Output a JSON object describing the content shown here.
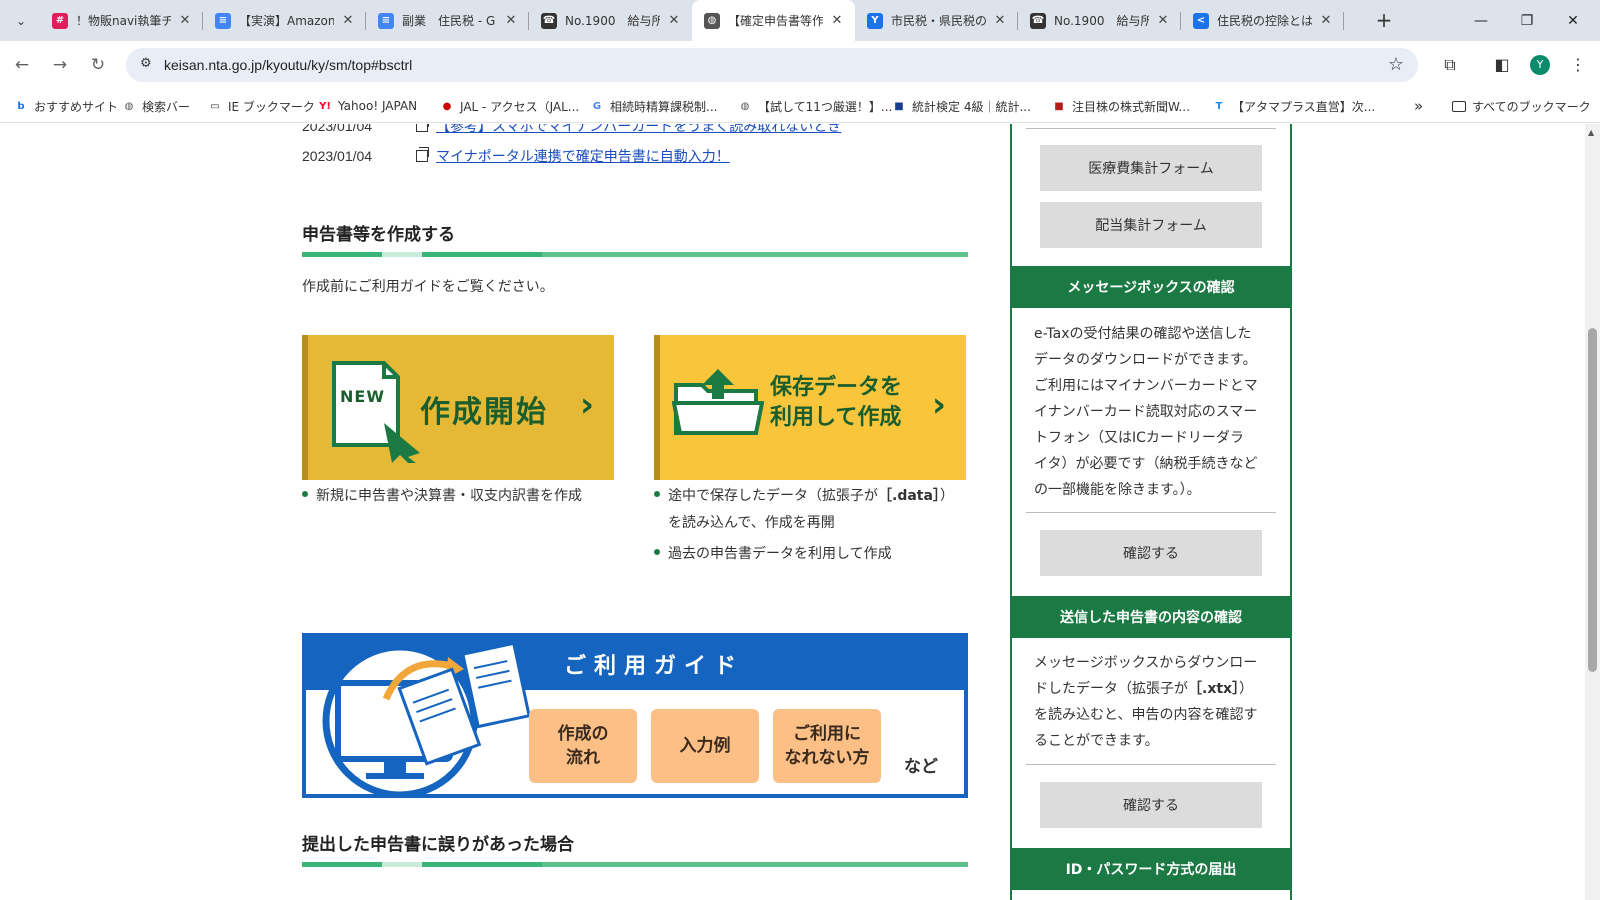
{
  "browser": {
    "tabs": [
      {
        "title": "！物販navi執筆チ",
        "fav_color": "#e01e5a",
        "fav": "#"
      },
      {
        "title": "【実演】Amazon中",
        "fav_color": "#4285f4",
        "fav": "≡"
      },
      {
        "title": "副業　住民税 - G",
        "fav_color": "#4285f4",
        "fav": "≡"
      },
      {
        "title": "No.1900　給与所",
        "fav_color": "#333333",
        "fav": "☎"
      },
      {
        "title": "【確定申告書等作",
        "fav_color": "#555555",
        "fav": "◍"
      },
      {
        "title": "市民税・県民税の",
        "fav_color": "#1a73e8",
        "fav": "Y"
      },
      {
        "title": "No.1900　給与所",
        "fav_color": "#333333",
        "fav": "☎"
      },
      {
        "title": "住民税の控除とは",
        "fav_color": "#1a73e8",
        "fav": "<"
      }
    ],
    "active_tab_index": 4,
    "url": "keisan.nta.go.jp/kyoutu/ky/sm/top#bsctrl",
    "avatar_letter": "Y",
    "bookmarks": [
      {
        "label": "おすすめサイト",
        "icon": "b",
        "color": "#1a73e8"
      },
      {
        "label": "検索バー",
        "icon": "◍",
        "color": "#555555"
      },
      {
        "label": "IE ブックマーク",
        "icon": "▭",
        "color": "#333333"
      },
      {
        "label": "Yahoo! JAPAN",
        "icon": "Y!",
        "color": "#ff0033"
      },
      {
        "label": "JAL - アクセス（JAL...",
        "icon": "●",
        "color": "#cc0000"
      },
      {
        "label": "相続時精算課税制...",
        "icon": "G",
        "color": "#4285f4"
      },
      {
        "label": "【試して11つ厳選！】...",
        "icon": "◍",
        "color": "#555555"
      },
      {
        "label": "統計検定 4級｜統計...",
        "icon": "■",
        "color": "#1a3d8f"
      },
      {
        "label": "注目株の株式新聞W...",
        "icon": "■",
        "color": "#b71c1c"
      },
      {
        "label": "【アタマプラス直営】次...",
        "icon": "T",
        "color": "#1e88e5"
      }
    ],
    "more_bookmarks": "»",
    "all_bookmarks": "すべてのブックマーク"
  },
  "news": [
    {
      "date": "2023/01/04",
      "text": "【参考】スマホでマイナンバーカードをうまく読み取れないとき"
    },
    {
      "date": "2023/01/04",
      "text": "マイナポータル連携で確定申告書に自動入力！"
    }
  ],
  "create_section": {
    "title": "申告書等を作成する",
    "lead": "作成前にご利用ガイドをご覧ください。",
    "create_button": {
      "badge": "NEW",
      "label": "作成開始"
    },
    "saved_button": {
      "line1": "保存データを",
      "line2": "利用して作成"
    },
    "create_notes": [
      "新規に申告書や決算書・収支内訳書を作成"
    ],
    "saved_notes": [
      {
        "pre": "途中で保存したデータ（拡張子が",
        "ext": "［.data］",
        "post": "）",
        "line2": "を読み込んで、作成を再開"
      },
      {
        "pre": "過去の申告書データを利用して作成"
      }
    ]
  },
  "guide": {
    "title": "ご利用ガイド",
    "pill1_l1": "作成の",
    "pill1_l2": "流れ",
    "pill2": "入力例",
    "pill3_l1": "ご利用に",
    "pill3_l2": "なれない方",
    "etc": "など"
  },
  "error_section": {
    "title": "提出した申告書に誤りがあった場合"
  },
  "sidebar": {
    "medical_form": "医療費集計フォーム",
    "dividend_form": "配当集計フォーム",
    "msgbox": {
      "header": "メッセージボックスの確認",
      "desc": [
        "e-Taxの受付結果の確認や送信した",
        "データのダウンロードができます。",
        "ご利用にはマイナンバーカードとマ",
        "イナンバーカード読取対応のスマー",
        "トフォン（又はICカードリーダラ",
        "イタ）が必要です（納税手続きなど",
        "の一部機能を除きます。）。"
      ],
      "button": "確認する"
    },
    "sent": {
      "header": "送信した申告書の内容の確認",
      "desc_l1": "メッセージボックスからダウンロー",
      "desc_l2_pre": "ドしたデータ（拡張子が",
      "desc_l2_ext": "［.xtx］",
      "desc_l2_post": "）",
      "desc_l3": "を読み込むと、申告の内容を確認す",
      "desc_l4": "ることができます。",
      "button": "確認する"
    },
    "idpw_header": "ID・パスワード方式の届出"
  },
  "colors": {
    "green": "#1b7a44",
    "gold": "#e5b935",
    "yellow": "#f9c53a",
    "guide_blue": "#1565c0"
  }
}
